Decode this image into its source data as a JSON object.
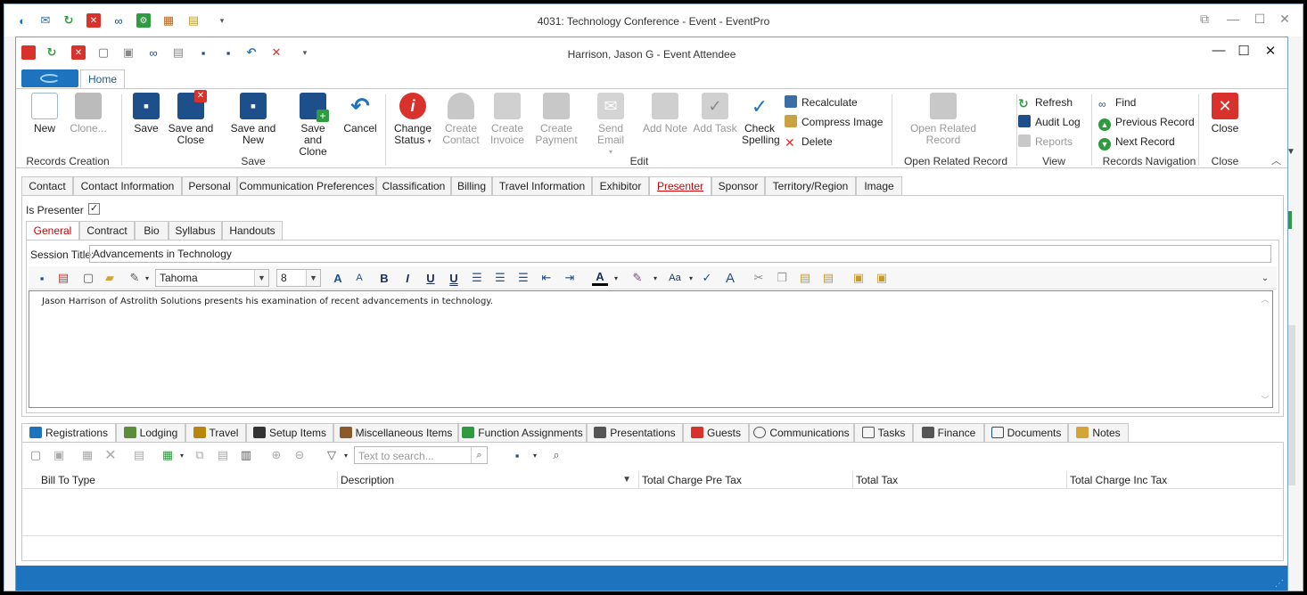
{
  "outer_window": {
    "title": "4031: Technology Conference - Event - EventPro"
  },
  "inner_window": {
    "title": "Harrison, Jason G - Event Attendee"
  },
  "ribbon": {
    "tab_home": "Home",
    "records_creation": {
      "label": "Records Creation",
      "new": "New",
      "clone": "Clone..."
    },
    "save": {
      "label": "Save",
      "save": "Save",
      "save_close_1": "Save and",
      "save_close_2": "Close",
      "save_new": "Save and New",
      "save_clone_1": "Save and",
      "save_clone_2": "Clone",
      "cancel": "Cancel"
    },
    "edit": {
      "label": "Edit",
      "change_status_1": "Change",
      "change_status_2": "Status",
      "create_contact_1": "Create",
      "create_contact_2": "Contact",
      "create_invoice_1": "Create",
      "create_invoice_2": "Invoice",
      "create_payment_1": "Create",
      "create_payment_2": "Payment",
      "send_email": "Send Email",
      "add_note": "Add Note",
      "add_task": "Add Task",
      "check_spelling_1": "Check",
      "check_spelling_2": "Spelling",
      "recalculate": "Recalculate",
      "compress_image": "Compress Image",
      "delete": "Delete"
    },
    "open_related": {
      "label": "Open Related Record",
      "btn_1": "Open Related",
      "btn_2": "Record"
    },
    "view": {
      "label": "View",
      "refresh": "Refresh",
      "audit_log": "Audit Log",
      "reports": "Reports"
    },
    "navigation": {
      "label": "Records Navigation",
      "find": "Find",
      "previous": "Previous Record",
      "next": "Next Record"
    },
    "close": {
      "label": "Close",
      "close": "Close"
    }
  },
  "main_tabs": [
    "Contact",
    "Contact Information",
    "Personal",
    "Communication Preferences",
    "Classification",
    "Billing",
    "Travel Information",
    "Exhibitor",
    "Presenter",
    "Sponsor",
    "Territory/Region",
    "Image"
  ],
  "presenter": {
    "is_presenter_label": "Is Presenter",
    "is_presenter_checked": true,
    "sub_tabs": [
      "General",
      "Contract",
      "Bio",
      "Syllabus",
      "Handouts"
    ],
    "session_title_label": "Session Title:",
    "session_title_value": "Advancements in Technology",
    "font_name": "Tahoma",
    "font_size": "8",
    "body_text": "Jason Harrison of Astrolith Solutions presents his examination of recent advancements in technology."
  },
  "bottom_tabs": [
    "Registrations",
    "Lodging",
    "Travel",
    "Setup Items",
    "Miscellaneous Items",
    "Function Assignments",
    "Presentations",
    "Guests",
    "Communications",
    "Tasks",
    "Finance",
    "Documents",
    "Notes"
  ],
  "grid": {
    "search_placeholder": "Text to search...",
    "columns": [
      "Bill To Type",
      "Description",
      "Total Charge Pre Tax",
      "Total Tax",
      "Total Charge Inc Tax"
    ]
  },
  "colors": {
    "accent": "#1e73be",
    "red": "#d9312b",
    "green": "#2e9c3e"
  }
}
